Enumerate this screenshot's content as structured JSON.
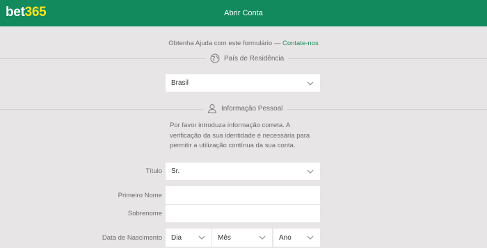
{
  "header": {
    "logo_bet": "bet",
    "logo_num": "365",
    "title": "Abrir Conta",
    "background": "#128a5e",
    "logo_accent": "#ffe418"
  },
  "help": {
    "text": "Obtenha Ajuda com este formulário —",
    "link": "Contate-nos"
  },
  "residence": {
    "heading": "País de Residência",
    "icon": "globe-icon",
    "country": "Brasil"
  },
  "personal": {
    "heading": "Informação Pessoal",
    "icon": "person-icon",
    "intro": "Por favor introduza informação correta. A verificação da sua identidade é necessária para permitir a utilização contínua da sua conta.",
    "title_label": "Título",
    "title_value": "Sr.",
    "first_name_label": "Primeiro Nome",
    "first_name_value": "",
    "last_name_label": "Sobrenome",
    "last_name_value": "",
    "dob_label": "Data de Nascimento",
    "dob_day": "Dia",
    "dob_month": "Mês",
    "dob_year": "Ano"
  }
}
